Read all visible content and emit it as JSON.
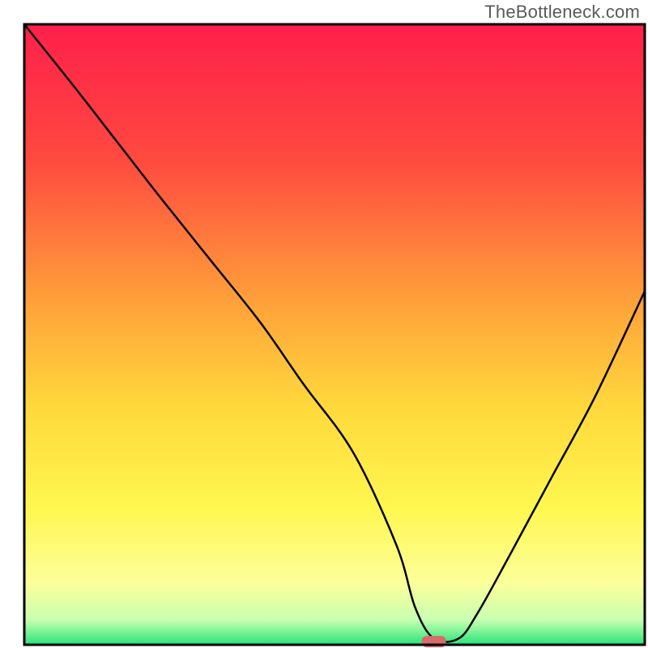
{
  "watermark": "TheBottleneck.com",
  "chart_data": {
    "type": "line",
    "title": "",
    "xlabel": "",
    "ylabel": "",
    "xlim": [
      0,
      100
    ],
    "ylim": [
      0,
      100
    ],
    "description": "Bottleneck curve overlaid on a vertical red→orange→yellow→green gradient background. V-shaped black line descends from upper-left to a minimum near x≈65 (green zone), then rises toward upper-right. Small rounded red marker at the curve minimum.",
    "series": [
      {
        "name": "bottleneck_curve",
        "x": [
          0,
          8,
          15,
          22,
          30,
          38,
          45,
          53,
          60,
          63,
          66,
          70,
          73,
          78,
          85,
          92,
          100
        ],
        "y": [
          100,
          90,
          81,
          72,
          62,
          52,
          42,
          31,
          16,
          6,
          1,
          1,
          5,
          14,
          27,
          40,
          57
        ]
      }
    ],
    "marker": {
      "x": 66,
      "y": 0.5,
      "color": "#d86b6b"
    },
    "gradient_stops": [
      {
        "offset": 0,
        "color": "#ff1f4b"
      },
      {
        "offset": 22,
        "color": "#ff4a3f"
      },
      {
        "offset": 45,
        "color": "#ffa23a"
      },
      {
        "offset": 62,
        "color": "#ffd93c"
      },
      {
        "offset": 78,
        "color": "#fff750"
      },
      {
        "offset": 90,
        "color": "#fcff9a"
      },
      {
        "offset": 96,
        "color": "#c8ffb0"
      },
      {
        "offset": 100,
        "color": "#28e57a"
      }
    ],
    "frame_color": "#000000"
  }
}
